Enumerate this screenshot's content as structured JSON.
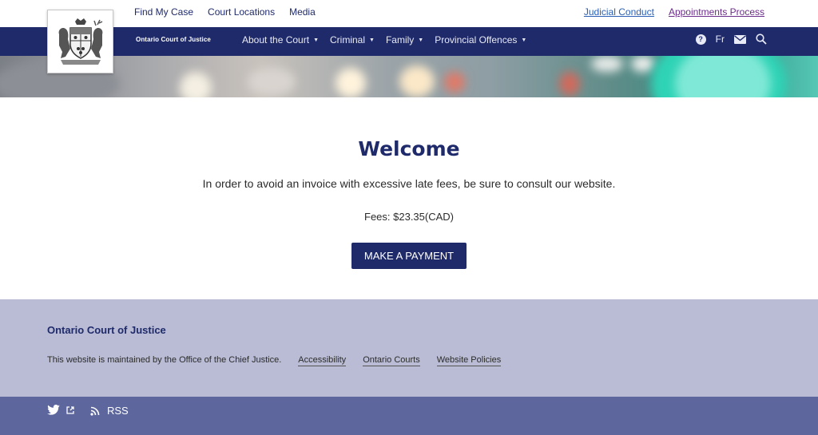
{
  "utility_nav": {
    "left_links": [
      "Find My Case",
      "Court Locations",
      "Media"
    ],
    "right_links": [
      "Judicial Conduct",
      "Appointments Process"
    ]
  },
  "brand": {
    "name": "Ontario Court of Justice"
  },
  "main_nav": {
    "items": [
      {
        "label": "About the Court"
      },
      {
        "label": "Criminal"
      },
      {
        "label": "Family"
      },
      {
        "label": "Provincial Offences"
      }
    ],
    "caret_glyph": "▼",
    "language_label": "Fr",
    "icons": [
      "help-icon",
      "mail-icon",
      "search-icon"
    ]
  },
  "welcome": {
    "heading": "Welcome",
    "message": "In order to avoid an invoice with excessive late fees, be sure to consult our website.",
    "fees": "Fees: $23.35(CAD)",
    "button_label": "MAKE A PAYMENT"
  },
  "footer": {
    "title": "Ontario Court of Justice",
    "maintained_by": "This website is maintained by the Office of the Chief Justice.",
    "links": [
      "Accessibility",
      "Ontario Courts",
      "Website Policies"
    ]
  },
  "bottom_bar": {
    "rss_label": "RSS",
    "icons": [
      "twitter-icon",
      "external-link-icon",
      "rss-icon"
    ]
  },
  "colors": {
    "navy": "#1f2a6b",
    "footer_bg": "#b9bcd4",
    "bottom_bar_bg": "#5d669d"
  }
}
